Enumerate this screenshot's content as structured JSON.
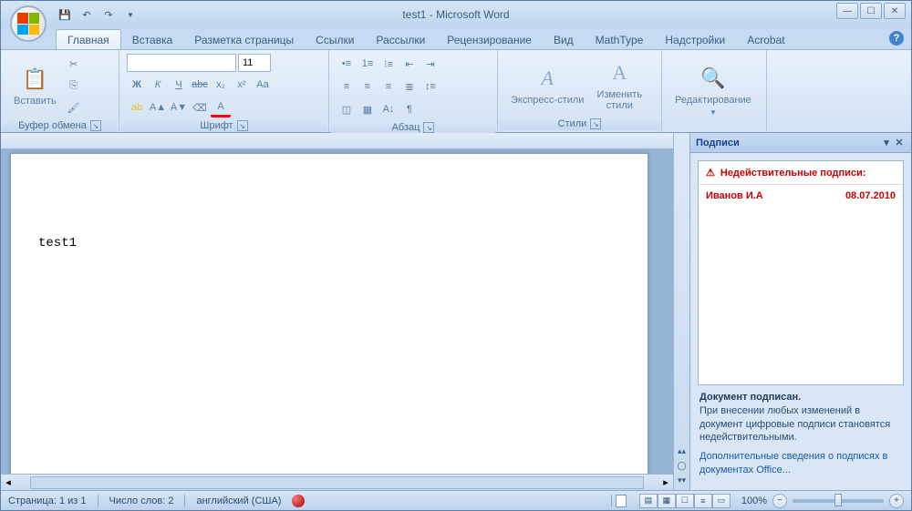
{
  "title": "test1 - Microsoft Word",
  "tabs": [
    "Главная",
    "Вставка",
    "Разметка страницы",
    "Ссылки",
    "Рассылки",
    "Рецензирование",
    "Вид",
    "MathType",
    "Надстройки",
    "Acrobat"
  ],
  "activeTab": 0,
  "ribbon": {
    "clipboard": {
      "label": "Буфер обмена",
      "paste": "Вставить"
    },
    "font": {
      "label": "Шрифт",
      "size": "11",
      "fontname": ""
    },
    "paragraph": {
      "label": "Абзац"
    },
    "styles": {
      "label": "Стили",
      "quick": "Экспресс-стили",
      "change": "Изменить\nстили"
    },
    "editing": {
      "label": "Редактирование"
    }
  },
  "document": {
    "text": "test1"
  },
  "taskpane": {
    "title": "Подписи",
    "invalid_header": "Недействительные подписи:",
    "signer": "Иванов И.А",
    "date": "08.07.2010",
    "signed_msg": "Документ подписан.",
    "warning": "При внесении любых изменений в документ цифровые подписи становятся недействительными.",
    "link": "Дополнительные сведения о подписях в документах Office..."
  },
  "status": {
    "page": "Страница: 1 из 1",
    "words": "Число слов: 2",
    "lang": "английский (США)",
    "zoom": "100%"
  }
}
